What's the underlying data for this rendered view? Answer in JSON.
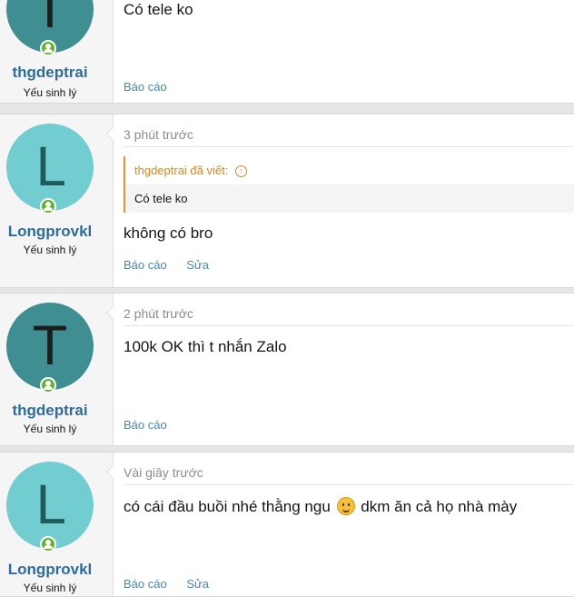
{
  "posts": [
    {
      "avatar_letter": "T",
      "username": "thgdeptrai",
      "user_title": "Yếu sinh lý",
      "message": "Có tele ko",
      "actions": [
        "Báo cáo"
      ]
    },
    {
      "avatar_letter": "L",
      "username": "Longprovkl",
      "user_title": "Yếu sinh lý",
      "time": "3 phút trước",
      "quote": {
        "author": "thgdeptrai đã viết:",
        "text": "Có tele ko"
      },
      "message": "không có bro",
      "actions": [
        "Báo cáo",
        "Sửa"
      ]
    },
    {
      "avatar_letter": "T",
      "username": "thgdeptrai",
      "user_title": "Yếu sinh lý",
      "time": "2 phút trước",
      "message": "100k OK thì t nhắn Zalo",
      "actions": [
        "Báo cáo"
      ]
    },
    {
      "avatar_letter": "L",
      "username": "Longprovkl",
      "user_title": "Yếu sinh lý",
      "time": "Vài giây trước",
      "message_before_emoji": "có cái đầu buồi nhé thằng ngu",
      "message_after_emoji": "dkm ăn cả họ nhà mày",
      "emoji": "slightly-smiling-face-emoji",
      "actions": [
        "Báo cáo",
        "Sửa"
      ]
    }
  ],
  "colors": {
    "username": "#2f6c9c",
    "action_link": "#4a86b4",
    "quote_accent": "#e0841f",
    "avatar_teal": "#3f8f92",
    "avatar_cyan": "#72cdd1",
    "online_badge": "#63b32e"
  }
}
